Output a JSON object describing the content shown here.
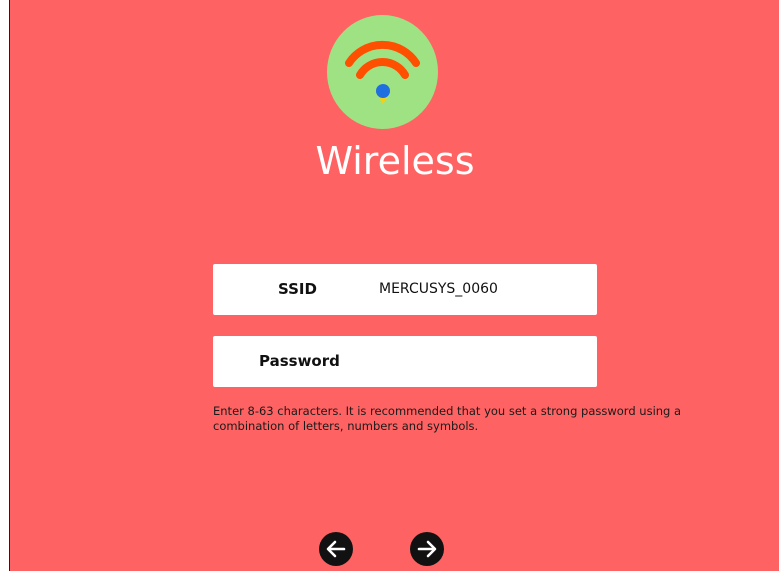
{
  "page": {
    "title": "Wireless",
    "background_color": "#ff6262",
    "logo_color": "#9fe284",
    "logo_icon": "wifi-icon"
  },
  "ssid": {
    "label": "SSID",
    "value": "MERCUSYS_0060"
  },
  "password": {
    "label": "Password",
    "value": ""
  },
  "hint": "Enter 8-63 characters. It is recommended that you set a strong password using a combination of letters, numbers and symbols.",
  "nav": {
    "back_icon": "arrow-left-icon",
    "next_icon": "arrow-right-icon"
  }
}
